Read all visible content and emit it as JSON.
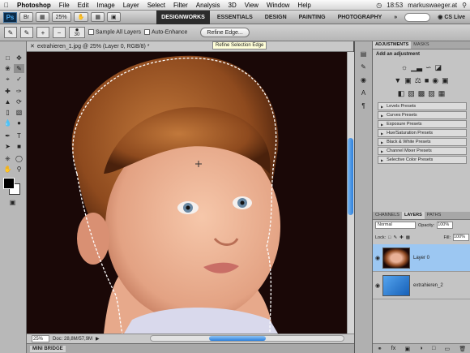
{
  "menubar": {
    "apple": "",
    "items": [
      "Photoshop",
      "File",
      "Edit",
      "Image",
      "Layer",
      "Select",
      "Filter",
      "Analysis",
      "3D",
      "View",
      "Window",
      "Help"
    ],
    "time": "18:53",
    "user": "markuswaeger.at"
  },
  "appbar": {
    "logo": "Ps",
    "zoom": "25%",
    "workspaces": [
      "DESIGNWORKS",
      "ESSENTIALS",
      "DESIGN",
      "PAINTING",
      "PHOTOGRAPHY"
    ],
    "more": "»",
    "cslive": "CS Live"
  },
  "options": {
    "brush_size": "30",
    "sample_all": "Sample All Layers",
    "auto_enhance": "Auto-Enhance",
    "refine": "Refine Edge...",
    "tooltip": "Refine Selection Edge"
  },
  "document": {
    "tab": "extrahieren_1.jpg @ 25% (Layer 0, RGB/8) *",
    "zoom": "25%",
    "doc": "Doc: 28,8M/57,9M",
    "minibridge": "MINI BRIDGE"
  },
  "adjustments": {
    "tabs": [
      "ADJUSTMENTS",
      "MASKS"
    ],
    "title": "Add an adjustment",
    "presets": [
      "Levels Presets",
      "Curves Presets",
      "Exposure Presets",
      "Hue/Saturation Presets",
      "Black & White Presets",
      "Channel Mixer Presets",
      "Selective Color Presets"
    ]
  },
  "layers": {
    "tabs": [
      "CHANNELS",
      "LAYERS",
      "PATHS"
    ],
    "blend": "Normal",
    "opacity_label": "Opacity:",
    "opacity": "100%",
    "lock_label": "Lock:",
    "fill_label": "Fill:",
    "fill": "100%",
    "items": [
      {
        "name": "Layer 0"
      },
      {
        "name": "extrahieren_2"
      }
    ]
  },
  "colors": {
    "accent": "#2b7fdc",
    "selection": "#9cc7f2"
  }
}
